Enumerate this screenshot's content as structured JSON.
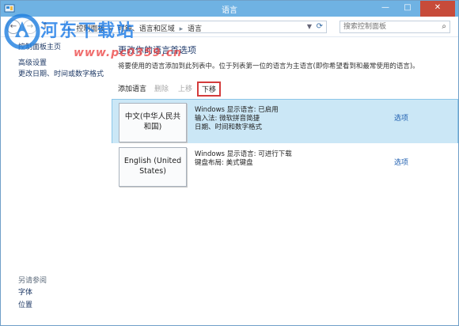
{
  "window": {
    "title": "语言"
  },
  "nav": {
    "breadcrumbs": [
      "控制面板",
      "时钟、语言和区域",
      "语言"
    ],
    "search_placeholder": "搜索控制面板"
  },
  "sidebar": {
    "home_label": "控制面板主页",
    "links": [
      "高级设置",
      "更改日期、时间或数字格式"
    ],
    "see_also_label": "另请参阅",
    "see_also_links": [
      "字体",
      "位置"
    ]
  },
  "main": {
    "title": "更改你的语言首选项",
    "description": "将要使用的语言添加到此列表中。位于列表第一位的语言为主语言(即你希望看到和最常使用的语言)。",
    "toolbar": {
      "add": "添加语言",
      "remove": "删除",
      "move_up": "上移",
      "move_down": "下移"
    },
    "languages": [
      {
        "name_line1": "中文(中华人民共",
        "name_line2": "和国)",
        "info": [
          "Windows 显示语言: 已启用",
          "输入法: 微软拼音简捷",
          "日期、时间和数字格式"
        ],
        "options": "选项"
      },
      {
        "name_line1": "English (United",
        "name_line2": "States)",
        "info": [
          "Windows 显示语言: 可进行下载",
          "键盘布局: 美式键盘"
        ],
        "options": "选项"
      }
    ]
  },
  "watermark": {
    "brand": "河东下载站",
    "url": "www.pc0359.cn"
  },
  "colors": {
    "titlebar": "#6fb2e3",
    "close": "#c74b3a",
    "selected_row": "#cbe7f6",
    "highlight_border": "#d43c3c",
    "link": "#1f5fb0"
  }
}
